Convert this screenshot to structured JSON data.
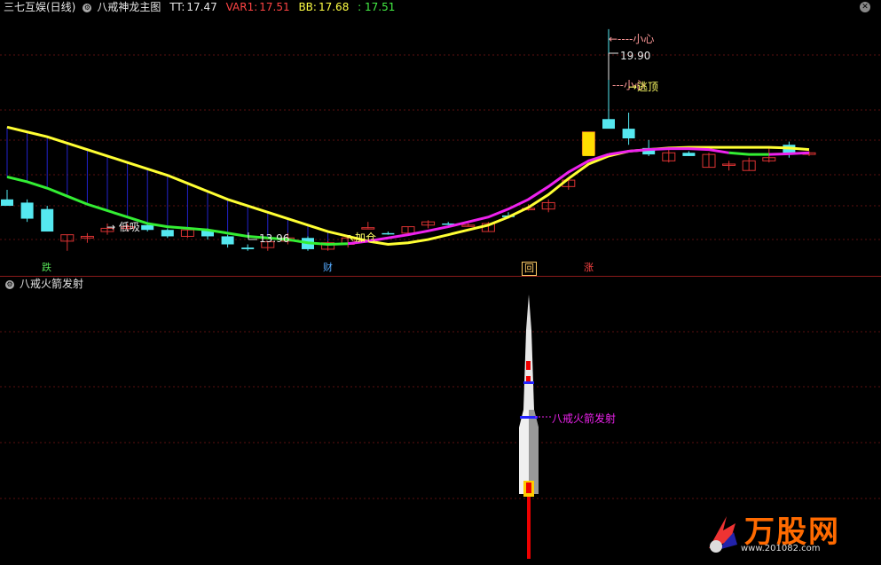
{
  "header": {
    "stock": "三七互娱(日线)",
    "indicator": "八戒神龙主图",
    "tt_label": "TT:",
    "tt_value": "17.47",
    "var1_label": "VAR1:",
    "var1_value": "17.51",
    "bb_label": "BB:",
    "bb_value": "17.68",
    "extra_value": ": 17.51"
  },
  "lower_pane": {
    "title": "八戒火箭发射",
    "rocket_label": "八戒火箭发射"
  },
  "annotations": {
    "high_price": "19.90",
    "low_price": "13.96",
    "careful_top": "小心",
    "careful_mid": "小心",
    "escape_top": "逃顶",
    "low_buy": "低吸",
    "add_position": "加仓"
  },
  "signals": [
    {
      "text": "跌",
      "color": "#55e055"
    },
    {
      "text": "财",
      "color": "#55aaff"
    },
    {
      "text": "回",
      "color": "#ffcc66"
    },
    {
      "text": "涨",
      "color": "#ff4444"
    }
  ],
  "watermark": {
    "brand": "万股网",
    "url": "www.201082.com"
  },
  "colors": {
    "yellow": "#ffff33",
    "green": "#33ee33",
    "magenta": "#ee22ee",
    "cyan": "#55e8f0",
    "red": "#dd3333",
    "blue": "#2222cc"
  },
  "chart_data": {
    "type": "candlestick",
    "candles": [
      {
        "o": 14.6,
        "h": 14.9,
        "l": 14.4,
        "c": 14.4
      },
      {
        "o": 14.5,
        "h": 14.6,
        "l": 13.9,
        "c": 14.0
      },
      {
        "o": 14.3,
        "h": 14.4,
        "l": 13.6,
        "c": 13.6
      },
      {
        "o": 13.3,
        "h": 13.5,
        "l": 13.0,
        "c": 13.5
      },
      {
        "o": 13.4,
        "h": 13.55,
        "l": 13.25,
        "c": 13.45
      },
      {
        "o": 13.6,
        "h": 13.85,
        "l": 13.5,
        "c": 13.7
      },
      {
        "o": 13.7,
        "h": 13.85,
        "l": 13.6,
        "c": 13.75
      },
      {
        "o": 13.8,
        "h": 13.85,
        "l": 13.6,
        "c": 13.65
      },
      {
        "o": 13.65,
        "h": 13.7,
        "l": 13.4,
        "c": 13.45
      },
      {
        "o": 13.45,
        "h": 13.65,
        "l": 13.4,
        "c": 13.65
      },
      {
        "o": 13.65,
        "h": 13.7,
        "l": 13.35,
        "c": 13.45
      },
      {
        "o": 13.45,
        "h": 13.5,
        "l": 13.1,
        "c": 13.2
      },
      {
        "o": 13.1,
        "h": 13.2,
        "l": 13.0,
        "c": 13.05
      },
      {
        "o": 13.1,
        "h": 13.3,
        "l": 13.0,
        "c": 13.28
      },
      {
        "o": 13.3,
        "h": 13.55,
        "l": 13.2,
        "c": 13.4
      },
      {
        "o": 13.4,
        "h": 13.45,
        "l": 13.0,
        "c": 13.05
      },
      {
        "o": 13.05,
        "h": 13.3,
        "l": 13.0,
        "c": 13.25
      },
      {
        "o": 13.2,
        "h": 13.45,
        "l": 13.1,
        "c": 13.4
      },
      {
        "o": 13.7,
        "h": 13.9,
        "l": 13.7,
        "c": 13.72
      },
      {
        "o": 13.55,
        "h": 13.6,
        "l": 13.5,
        "c": 13.52
      },
      {
        "o": 13.55,
        "h": 13.75,
        "l": 13.5,
        "c": 13.75
      },
      {
        "o": 13.8,
        "h": 13.95,
        "l": 13.7,
        "c": 13.9
      },
      {
        "o": 13.85,
        "h": 13.9,
        "l": 13.8,
        "c": 13.83
      },
      {
        "o": 13.8,
        "h": 13.85,
        "l": 13.75,
        "c": 13.8
      },
      {
        "o": 13.6,
        "h": 13.9,
        "l": 13.6,
        "c": 13.85
      },
      {
        "o": 14.1,
        "h": 14.2,
        "l": 14.0,
        "c": 14.05
      },
      {
        "o": 14.3,
        "h": 14.45,
        "l": 14.25,
        "c": 14.32
      },
      {
        "o": 14.3,
        "h": 14.6,
        "l": 14.2,
        "c": 14.5
      },
      {
        "o": 15.0,
        "h": 15.25,
        "l": 14.9,
        "c": 15.2
      },
      {
        "o": 16.0,
        "h": 16.7,
        "l": 16.0,
        "c": 16.7
      },
      {
        "o": 17.1,
        "h": 19.9,
        "l": 17.0,
        "c": 16.8
      },
      {
        "o": 16.8,
        "h": 17.3,
        "l": 16.3,
        "c": 16.5
      },
      {
        "o": 16.2,
        "h": 16.45,
        "l": 15.95,
        "c": 16.0
      },
      {
        "o": 15.8,
        "h": 16.2,
        "l": 15.75,
        "c": 16.05
      },
      {
        "o": 16.05,
        "h": 16.1,
        "l": 15.95,
        "c": 15.95
      },
      {
        "o": 15.6,
        "h": 16.05,
        "l": 15.6,
        "c": 16.0
      },
      {
        "o": 15.7,
        "h": 15.8,
        "l": 15.5,
        "c": 15.7
      },
      {
        "o": 15.5,
        "h": 15.9,
        "l": 15.5,
        "c": 15.8
      },
      {
        "o": 15.8,
        "h": 16.2,
        "l": 15.75,
        "c": 15.9
      },
      {
        "o": 16.3,
        "h": 16.4,
        "l": 15.9,
        "c": 16.0
      },
      {
        "o": 16.0,
        "h": 16.1,
        "l": 15.95,
        "c": 16.05
      }
    ],
    "ma_upper": [
      16.85,
      16.7,
      16.55,
      16.35,
      16.15,
      15.95,
      15.75,
      15.55,
      15.35,
      15.1,
      14.85,
      14.6,
      14.4,
      14.2,
      14.0,
      13.8,
      13.6,
      13.45,
      13.3,
      13.2,
      13.25,
      13.35,
      13.5,
      13.65,
      13.8,
      14.05,
      14.35,
      14.75,
      15.25,
      15.7,
      15.95,
      16.1,
      16.15,
      16.2,
      16.22,
      16.22,
      16.22,
      16.22,
      16.22,
      16.2,
      16.15
    ],
    "ma_lower": [
      15.3,
      15.15,
      14.95,
      14.7,
      14.45,
      14.25,
      14.05,
      13.85,
      13.75,
      13.7,
      13.65,
      13.55,
      13.45,
      13.4,
      13.35,
      13.25,
      13.2,
      13.22,
      13.3,
      13.4,
      13.5,
      13.62,
      13.75,
      13.9,
      14.05,
      14.3,
      14.6,
      15.0,
      15.45,
      15.8,
      16.0,
      16.1,
      16.15,
      16.18,
      16.18,
      16.15,
      16.05,
      16.0,
      16.0,
      16.02,
      16.05
    ],
    "lower_color_split": [
      17,
      30,
      36
    ]
  }
}
